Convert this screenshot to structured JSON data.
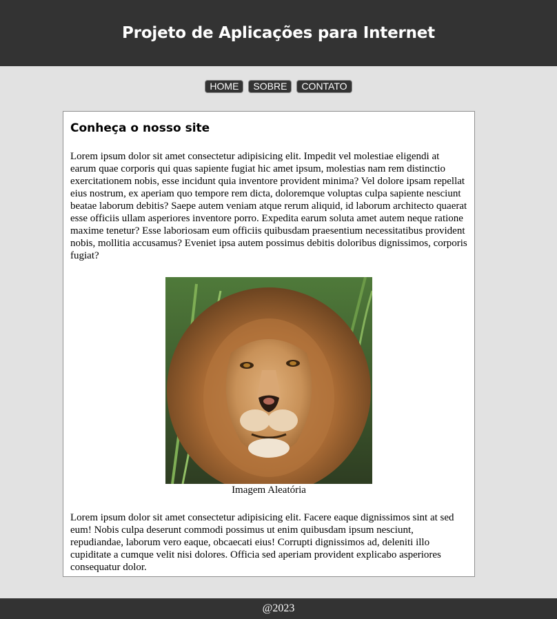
{
  "header": {
    "title": "Projeto de Aplicações para Internet"
  },
  "nav": {
    "items": [
      "HOME",
      "SOBRE",
      "CONTATO"
    ]
  },
  "main": {
    "heading": "Conheça o nosso site",
    "paragraph1": "Lorem ipsum dolor sit amet consectetur adipisicing elit. Impedit vel molestiae eligendi at earum quae corporis qui quas sapiente fugiat hic amet ipsum, molestias nam rem distinctio exercitationem nobis, esse incidunt quia inventore provident minima? Vel dolore ipsam repellat eius nostrum, ex aperiam quo tempore rem dicta, doloremque voluptas culpa sapiente nesciunt beatae laborum debitis? Saepe autem veniam atque rerum aliquid, id laborum architecto quaerat esse officiis ullam asperiores inventore porro. Expedita earum soluta amet autem neque ratione maxime tenetur? Esse laboriosam eum officiis quibusdam praesentium necessitatibus provident nobis, mollitia accusamus? Eveniet ipsa autem possimus debitis doloribus dignissimos, corporis fugiat?",
    "image_caption": "Imagem Aleatória",
    "paragraph2": "Lorem ipsum dolor sit amet consectetur adipisicing elit. Facere eaque dignissimos sint at sed eum! Nobis culpa deserunt commodi possimus ut enim quibusdam ipsum nesciunt, repudiandae, laborum vero eaque, obcaecati eius! Corrupti dignissimos ad, deleniti illo cupiditate a cumque velit nisi dolores. Officia sed aperiam provident explicabo asperiores consequatur dolor."
  },
  "footer": {
    "text": "@2023"
  },
  "colors": {
    "dark": "#333333",
    "background": "#e2e2e2",
    "card": "#ffffff"
  }
}
